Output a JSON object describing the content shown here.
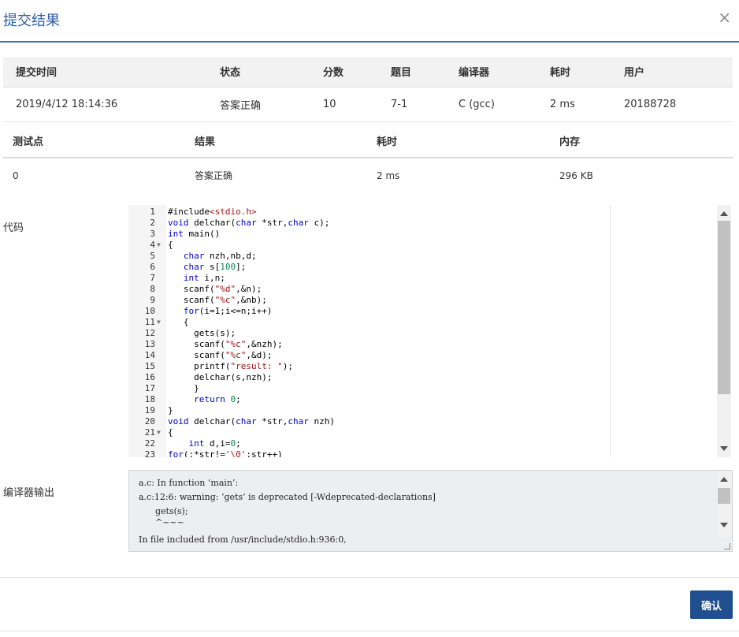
{
  "dialog": {
    "title": "提交结果",
    "close_glyph": "×",
    "confirm_label": "确认"
  },
  "summary": {
    "headers": [
      "提交时间",
      "状态",
      "分数",
      "题目",
      "编译器",
      "耗时",
      "用户"
    ],
    "row": {
      "time": "2019/4/12 18:14:36",
      "status": "答案正确",
      "score": "10",
      "problem": "7-1",
      "compiler": "C (gcc)",
      "duration": "2 ms",
      "user": "20188728"
    }
  },
  "cases": {
    "headers": [
      "测试点",
      "结果",
      "耗时",
      "内存"
    ],
    "rows": [
      {
        "id": "0",
        "result": "答案正确",
        "duration": "2 ms",
        "memory": "296 KB"
      }
    ]
  },
  "code": {
    "label": "代码",
    "lines": [
      "#include<stdio.h>",
      "void delchar(char *str,char c);",
      "int main()",
      "{",
      "   char nzh,nb,d;",
      "   char s[100];",
      "   int i,n;",
      "   scanf(\"%d\",&n);",
      "   scanf(\"%c\",&nb);",
      "   for(i=1;i<=n;i++)",
      "   {",
      "     gets(s);",
      "     scanf(\"%c\",&nzh);",
      "     scanf(\"%c\",&d);",
      "     printf(\"result: \");",
      "     delchar(s,nzh);",
      "     }",
      "     return 0;",
      "}",
      "void delchar(char *str,char nzh)",
      "{",
      "    int d,i=0;",
      "for(;*str!='\\0';str++)"
    ],
    "fold_lines": [
      4,
      11,
      21
    ]
  },
  "compiler_output": {
    "label": "编译器输出",
    "lines": [
      "a.c: In function ‘main’:",
      "a.c:12:6: warning: ‘gets’ is deprecated [-Wdeprecated-declarations]",
      "      gets(s);",
      "      ^~~~",
      "In file included from /usr/include/stdio.h:936:0,"
    ]
  }
}
